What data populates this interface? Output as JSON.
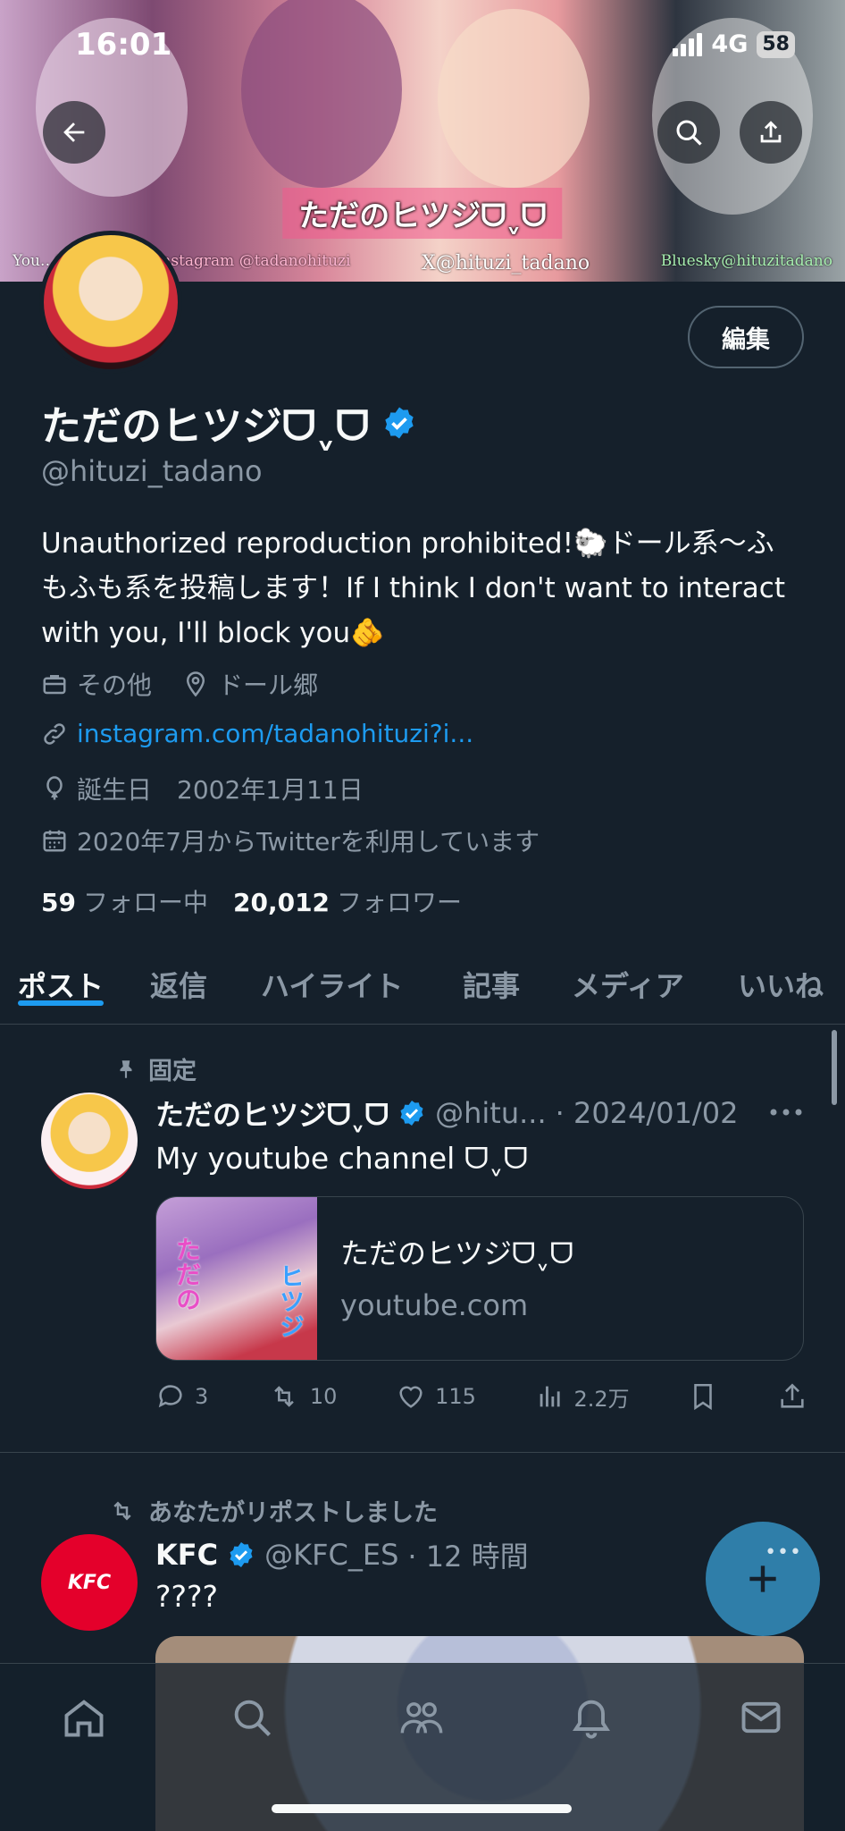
{
  "status_bar": {
    "time": "16:01",
    "network": "4G",
    "battery": "58"
  },
  "banner": {
    "caption": "ただのヒツジᗜˬᗜ",
    "handles": [
      "You…tuzi",
      "Instagram @tadanohituzi",
      "X@hituzi_tadano",
      "Bluesky@hituzitadano"
    ]
  },
  "profile": {
    "edit_label": "編集",
    "name": "ただのヒツジᗜˬᗜ",
    "handle": "@hituzi_tadano",
    "bio": "Unauthorized reproduction prohibited!🐑ドール系〜ふもふも系を投稿します！If I think I don't want to interact with you, I'll block you🫵",
    "category": "その他",
    "location": "ドール郷",
    "website": "instagram.com/tadanohituzi?i...",
    "birthday": "誕生日　2002年1月11日",
    "joined": "2020年7月からTwitterを利用しています",
    "following_count": "59",
    "following_label": "フォロー中",
    "followers_count": "20,012",
    "followers_label": "フォロワー"
  },
  "tabs": [
    "ポスト",
    "返信",
    "ハイライト",
    "記事",
    "メディア",
    "いいね"
  ],
  "pinned_post": {
    "pinned_label": "固定",
    "name": "ただのヒツジᗜˬᗜ",
    "handle": "@hitu...",
    "date": "· 2024/01/02",
    "text": "My youtube channel ᗜˬᗜ",
    "card_title": "ただのヒツジᗜˬᗜ",
    "card_domain": "youtube.com",
    "card_thumb_text": [
      "ただの",
      "ヒツジ"
    ],
    "replies": "3",
    "reposts": "10",
    "likes": "115",
    "views": "2.2万"
  },
  "repost": {
    "repost_label": "あなたがリポストしました",
    "name": "KFC",
    "handle": "@KFC_ES",
    "time": "· 12 時間",
    "text": "????",
    "avatar_text": "KFC"
  },
  "colors": {
    "accent": "#1d9bf0",
    "background": "#15202b",
    "muted": "#8b98a5",
    "fab": "#2f7ea9"
  }
}
